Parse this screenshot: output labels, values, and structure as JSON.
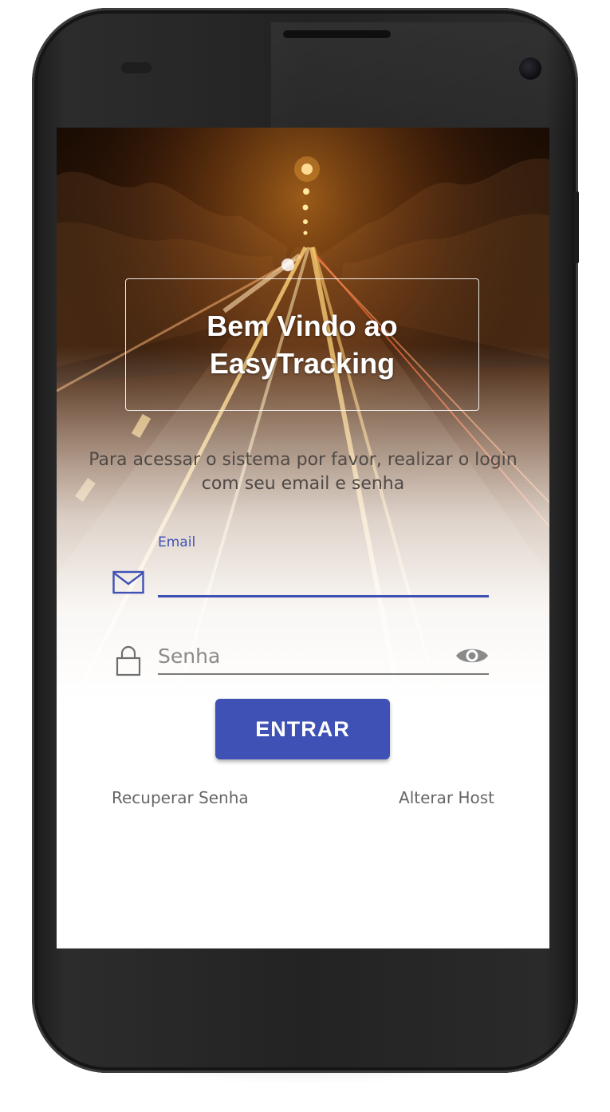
{
  "welcome": {
    "title": "Bem Vindo ao EasyTracking"
  },
  "instructions": {
    "text": "Para acessar o sistema por favor, realizar o login com seu email e senha"
  },
  "email_field": {
    "label": "Email",
    "value": "",
    "icon": "envelope-icon"
  },
  "password_field": {
    "placeholder": "Senha",
    "value": "",
    "icon": "lock-icon",
    "toggle_icon": "eye-icon"
  },
  "actions": {
    "enter_label": "ENTRAR",
    "recover_label": "Recuperar Senha",
    "host_label": "Alterar Host"
  },
  "colors": {
    "primary": "#3f51b5",
    "muted_text": "#666666",
    "subtitle_text": "#4f4a47"
  }
}
